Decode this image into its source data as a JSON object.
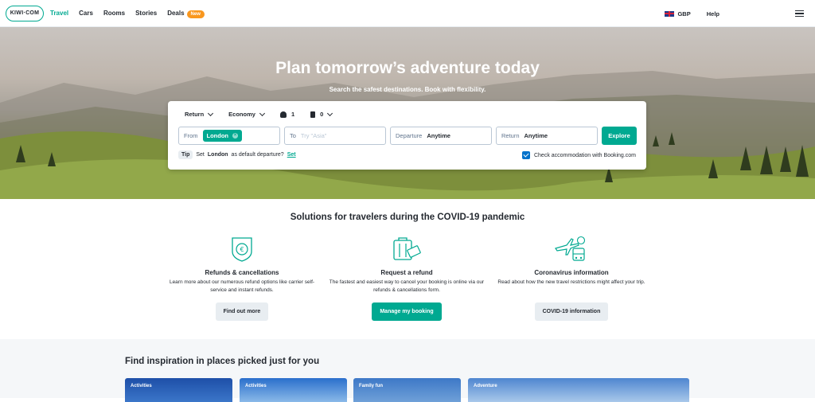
{
  "header": {
    "logo_text": "KIWI·COM",
    "nav": [
      "Travel",
      "Cars",
      "Rooms",
      "Stories",
      "Deals"
    ],
    "deals_badge": "New",
    "currency": "GBP",
    "help": "Help"
  },
  "hero": {
    "title": "Plan tomorrow’s adventure today",
    "subtitle": "Search the safest destinations. Book with flexibility."
  },
  "search": {
    "trip_type": "Return",
    "cabin_class": "Economy",
    "passengers": "1",
    "bags": "0",
    "from_label": "From",
    "from_value": "London",
    "to_label": "To",
    "to_placeholder": "Try \"Asia\"",
    "departure_label": "Departure",
    "departure_value": "Anytime",
    "return_label": "Return",
    "return_value": "Anytime",
    "explore_label": "Explore",
    "tip_label": "Tip",
    "tip_text_pre": "Set",
    "tip_city": "London",
    "tip_text_post": "as default departure?",
    "tip_link": "Set",
    "accommodation_label": "Check accommodation with Booking.com",
    "accommodation_checked": true
  },
  "covid": {
    "title": "Solutions for travelers during the COVID-19 pandemic",
    "items": [
      {
        "title": "Refunds & cancellations",
        "text": "Learn more about our numerous refund options like carrier self-service and instant refunds.",
        "button": "Find out more"
      },
      {
        "title": "Request a refund",
        "text": "The fastest and easiest way to cancel your booking is online via our refunds & cancellations form.",
        "button": "Manage my booking"
      },
      {
        "title": "Coronavirus information",
        "text": "Read about how the new travel restrictions might affect your trip.",
        "button": "COVID-19 information"
      }
    ]
  },
  "inspiration": {
    "title": "Find inspiration in places picked just for you",
    "cards": [
      "Activities",
      "Activities",
      "Family fun",
      "Adventure"
    ]
  },
  "colors": {
    "accent": "#00a991",
    "badge": "#f9971e",
    "checkbox": "#0172cb"
  }
}
